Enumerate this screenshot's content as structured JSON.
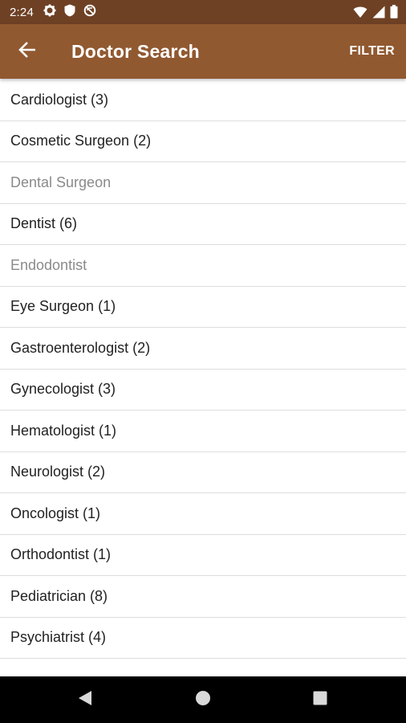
{
  "status_bar": {
    "time": "2:24",
    "left_icons": [
      "gear-icon",
      "shield-icon",
      "no-entry-icon"
    ],
    "right_icons": [
      "wifi-icon",
      "signal-icon",
      "battery-icon"
    ]
  },
  "app_bar": {
    "back_icon": "arrow-left-icon",
    "title": "Doctor Search",
    "filter_label": "FILTER",
    "color": "#915930"
  },
  "specialties": [
    {
      "label": "Cardiologist (3)",
      "enabled": true
    },
    {
      "label": "Cosmetic Surgeon (2)",
      "enabled": true
    },
    {
      "label": "Dental Surgeon",
      "enabled": false
    },
    {
      "label": "Dentist (6)",
      "enabled": true
    },
    {
      "label": "Endodontist",
      "enabled": false
    },
    {
      "label": "Eye Surgeon (1)",
      "enabled": true
    },
    {
      "label": "Gastroenterologist (2)",
      "enabled": true
    },
    {
      "label": "Gynecologist (3)",
      "enabled": true
    },
    {
      "label": "Hematologist (1)",
      "enabled": true
    },
    {
      "label": "Neurologist (2)",
      "enabled": true
    },
    {
      "label": "Oncologist (1)",
      "enabled": true
    },
    {
      "label": "Orthodontist (1)",
      "enabled": true
    },
    {
      "label": "Pediatrician (8)",
      "enabled": true
    },
    {
      "label": "Psychiatrist (4)",
      "enabled": true
    }
  ],
  "nav_bar": {
    "icons": [
      "back-triangle-icon",
      "home-circle-icon",
      "recents-square-icon"
    ]
  }
}
